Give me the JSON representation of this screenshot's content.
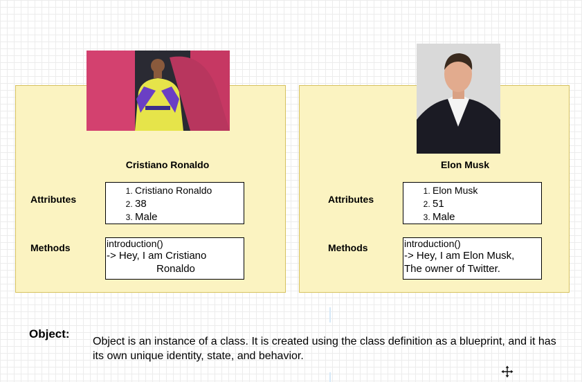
{
  "cards": [
    {
      "name": "Cristiano Ronaldo",
      "attributes_label": "Attributes",
      "methods_label": "Methods",
      "attributes": [
        "Cristiano Ronaldo",
        "38",
        "Male"
      ],
      "method_signature": "introduction()",
      "method_line1": "-> Hey, I am Cristiano",
      "method_line2": "Ronaldo",
      "photo_icon": "person-photo-icon"
    },
    {
      "name": "Elon Musk",
      "attributes_label": "Attributes",
      "methods_label": "Methods",
      "attributes": [
        "Elon Musk",
        "51",
        "Male"
      ],
      "method_signature": "introduction()",
      "method_line1": "-> Hey, I am Elon Musk,",
      "method_line2": "The owner of Twitter.",
      "photo_icon": "person-photo-icon"
    }
  ],
  "object": {
    "label": "Object:",
    "description": "Object is an instance of a class. It is created using the class definition as a blueprint, and it has its own unique identity, state, and behavior."
  },
  "colors": {
    "card_fill": "#fbf3c1",
    "card_border": "#d6c15e",
    "grid": "#ececec"
  }
}
